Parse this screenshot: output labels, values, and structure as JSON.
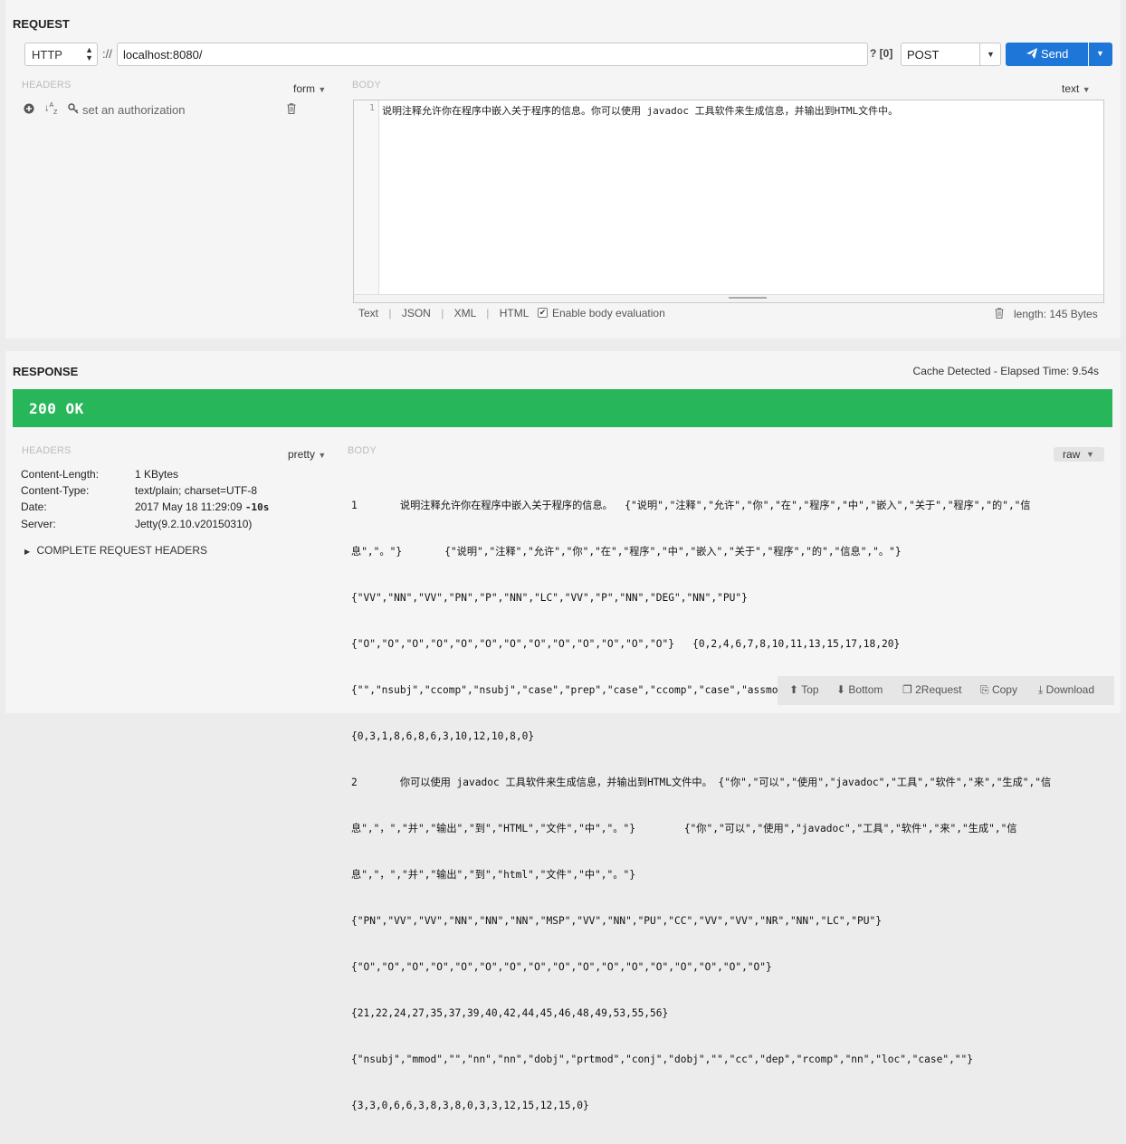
{
  "request": {
    "title": "REQUEST",
    "protocol": "HTTP",
    "scheme_sep": "://",
    "url": "localhost:8080/",
    "query_hint": "? [0]",
    "method": "POST",
    "send_label": "Send",
    "headers_label": "HEADERS",
    "headers_mode": "form",
    "auth_label": "set an authorization",
    "body_label": "BODY",
    "body_mode": "text",
    "body_line_no": "1",
    "body_text": "说明注释允许你在程序中嵌入关于程序的信息。你可以使用 javadoc 工具软件来生成信息，并输出到HTML文件中。",
    "body_tabs": [
      "Text",
      "JSON",
      "XML",
      "HTML"
    ],
    "enable_eval_label": "Enable body evaluation",
    "length_label": "length: 145 Bytes"
  },
  "response": {
    "title": "RESPONSE",
    "elapsed": "Cache Detected - Elapsed Time: 9.54s",
    "status": "200 OK",
    "headers_label": "HEADERS",
    "headers_mode": "pretty",
    "headers": [
      {
        "key": "Content-Length:",
        "value": "1 KBytes",
        "extra": ""
      },
      {
        "key": "Content-Type:",
        "value": "text/plain; charset=UTF-8",
        "extra": ""
      },
      {
        "key": "Date:",
        "value": "2017 May 18 11:29:09",
        "extra": "-10s"
      },
      {
        "key": "Server:",
        "value": "Jetty(9.2.10.v20150310)",
        "extra": ""
      }
    ],
    "complete_headers_label": "COMPLETE REQUEST HEADERS",
    "body_label": "BODY",
    "body_mode": "raw",
    "body_lines": [
      "1       说明注释允许你在程序中嵌入关于程序的信息。  {\"说明\",\"注释\",\"允许\",\"你\",\"在\",\"程序\",\"中\",\"嵌入\",\"关于\",\"程序\",\"的\",\"信",
      "息\",\"。\"}       {\"说明\",\"注释\",\"允许\",\"你\",\"在\",\"程序\",\"中\",\"嵌入\",\"关于\",\"程序\",\"的\",\"信息\",\"。\"}",
      "{\"VV\",\"NN\",\"VV\",\"PN\",\"P\",\"NN\",\"LC\",\"VV\",\"P\",\"NN\",\"DEG\",\"NN\",\"PU\"}",
      "{\"O\",\"O\",\"O\",\"O\",\"O\",\"O\",\"O\",\"O\",\"O\",\"O\",\"O\",\"O\",\"O\"}   {0,2,4,6,7,8,10,11,13,15,17,18,20}",
      "{\"\",\"nsubj\",\"ccomp\",\"nsubj\",\"case\",\"prep\",\"case\",\"ccomp\",\"case\",\"assmod\",\"case\",\"dobj\",\"\"}",
      "{0,3,1,8,6,8,6,3,10,12,10,8,0}",
      "2       你可以使用 javadoc 工具软件来生成信息，并输出到HTML文件中。 {\"你\",\"可以\",\"使用\",\"javadoc\",\"工具\",\"软件\",\"来\",\"生成\",\"信",
      "息\",\"，\",\"并\",\"输出\",\"到\",\"HTML\",\"文件\",\"中\",\"。\"}        {\"你\",\"可以\",\"使用\",\"javadoc\",\"工具\",\"软件\",\"来\",\"生成\",\"信",
      "息\",\"，\",\"并\",\"输出\",\"到\",\"html\",\"文件\",\"中\",\"。\"}",
      "{\"PN\",\"VV\",\"VV\",\"NN\",\"NN\",\"NN\",\"MSP\",\"VV\",\"NN\",\"PU\",\"CC\",\"VV\",\"VV\",\"NR\",\"NN\",\"LC\",\"PU\"}",
      "{\"O\",\"O\",\"O\",\"O\",\"O\",\"O\",\"O\",\"O\",\"O\",\"O\",\"O\",\"O\",\"O\",\"O\",\"O\",\"O\",\"O\"}",
      "{21,22,24,27,35,37,39,40,42,44,45,46,48,49,53,55,56}",
      "{\"nsubj\",\"mmod\",\"\",\"nn\",\"nn\",\"dobj\",\"prtmod\",\"conj\",\"dobj\",\"\",\"cc\",\"dep\",\"rcomp\",\"nn\",\"loc\",\"case\",\"\"}",
      "{3,3,0,6,6,3,8,3,8,0,3,3,12,15,12,15,0}"
    ],
    "footer": {
      "top": "Top",
      "bottom": "Bottom",
      "to_request": "2Request",
      "copy": "Copy",
      "download": "Download"
    }
  },
  "colors": {
    "status_green": "#27b75a",
    "send_blue": "#1d76d8"
  },
  "icons": [
    "plus-circle-icon",
    "sort-alpha-icon",
    "key-icon",
    "trash-icon",
    "paper-plane-icon",
    "checkbox-icon",
    "caret-right-icon",
    "arrow-circle-up-icon",
    "arrow-circle-down-icon",
    "files-icon",
    "copy-icon",
    "download-icon"
  ]
}
